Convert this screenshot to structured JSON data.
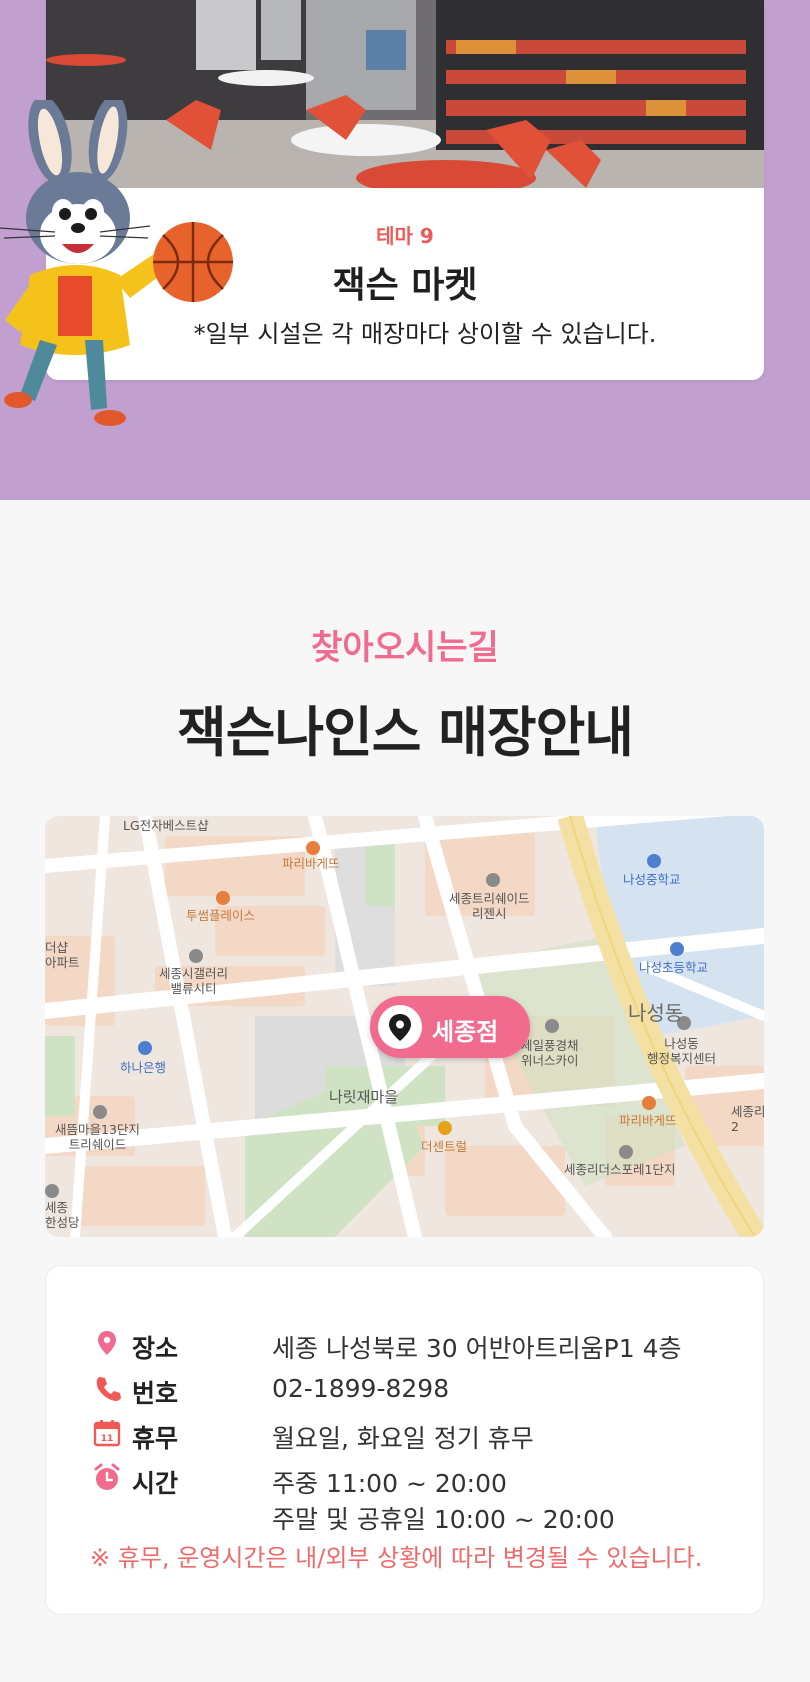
{
  "promo": {
    "theme_label": "테마 9",
    "title": "잭슨 마켓",
    "note": "*일부 시설은 각 매장마다 상이할 수 있습니다."
  },
  "directions": {
    "subtitle": "찾아오시는길",
    "title": "잭슨나인스 매장안내"
  },
  "map": {
    "pin_label": "세종점",
    "labels": {
      "lg": "LG전자베스트샵",
      "paris1": "파리바게뜨",
      "twosome": "투썸플레이스",
      "sejong_tri": "세종트리쉐이드\n리젠시",
      "naseong_middle": "나성중학교",
      "naseong_elem": "나성초등학교",
      "apt_left": "더샵\n아파트",
      "sejong_gallery": "세종시갤러리\n밸류시티",
      "naseongdong": "나성동",
      "jeil": "제일풍경채\n위너스카이",
      "welfare": "나성동\n행정복지센터",
      "hana": "하나은행",
      "naritjae": "나릿재마을",
      "saeum": "새뜸마을13단지\n트리쉐이드",
      "centrel": "더센트럴",
      "paris2": "파리바게뜨",
      "sejong_right": "세종리\n2",
      "leaders": "세종리더스포레1단지",
      "hanseong": "세종\n한성당"
    }
  },
  "info": {
    "location_key": "장소",
    "location_val": "세종 나성북로 30 어반아트리움P1 4층",
    "phone_key": "번호",
    "phone_val": "02-1899-8298",
    "closed_key": "휴무",
    "closed_val": "월요일, 화요일 정기 휴무",
    "hours_key": "시간",
    "hours_weekday": "주중 11:00 ~ 20:00",
    "hours_weekend": "주말 및 공휴일 10:00 ~ 20:00",
    "notice": "※ 휴무, 운영시간은 내/외부 상황에 따라 변경될 수 있습니다.",
    "calendar_day": "11"
  },
  "colors": {
    "promo_bg": "#c19fcf",
    "accent_pink": "#f16b8f",
    "accent_red": "#ef5a57",
    "notice_red": "#ef6b6b"
  }
}
